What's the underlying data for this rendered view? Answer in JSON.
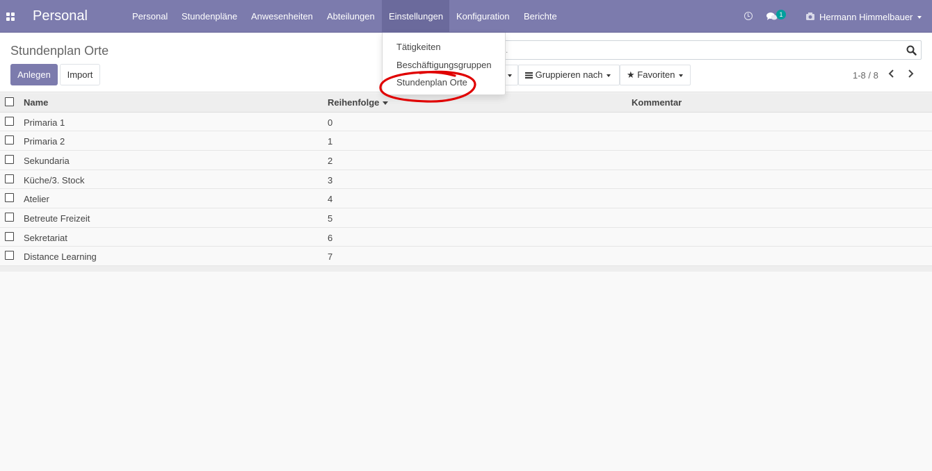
{
  "navbar": {
    "brand": "Personal",
    "menu": [
      "Personal",
      "Stundenpläne",
      "Anwesenheiten",
      "Abteilungen",
      "Einstellungen",
      "Konfiguration",
      "Berichte"
    ],
    "active_menu": "Einstellungen",
    "chat_count": "1",
    "user_name": "Hermann Himmelbauer",
    "accent_color": "#7c7bad"
  },
  "control_panel": {
    "title": "Stundenplan Orte",
    "create_label": "Anlegen",
    "import_label": "Import",
    "search_text": ".",
    "group_by_label": "Gruppieren nach",
    "favorites_label": "Favoriten",
    "pager": "1-8 / 8"
  },
  "dropdown": {
    "items": [
      "Tätigkeiten",
      "Beschäftigungsgruppen",
      "Stundenplan Orte"
    ],
    "highlighted": "Stundenplan Orte",
    "annotation_color": "#e00000"
  },
  "table": {
    "columns": [
      "Name",
      "Reihenfolge",
      "Kommentar"
    ],
    "sorted_column": "Reihenfolge",
    "rows": [
      {
        "name": "Primaria 1",
        "sequence": "0",
        "comment": ""
      },
      {
        "name": "Primaria 2",
        "sequence": "1",
        "comment": ""
      },
      {
        "name": "Sekundaria",
        "sequence": "2",
        "comment": ""
      },
      {
        "name": "Küche/3. Stock",
        "sequence": "3",
        "comment": ""
      },
      {
        "name": "Atelier",
        "sequence": "4",
        "comment": ""
      },
      {
        "name": "Betreute Freizeit",
        "sequence": "5",
        "comment": ""
      },
      {
        "name": "Sekretariat",
        "sequence": "6",
        "comment": ""
      },
      {
        "name": "Distance Learning",
        "sequence": "7",
        "comment": ""
      }
    ]
  }
}
